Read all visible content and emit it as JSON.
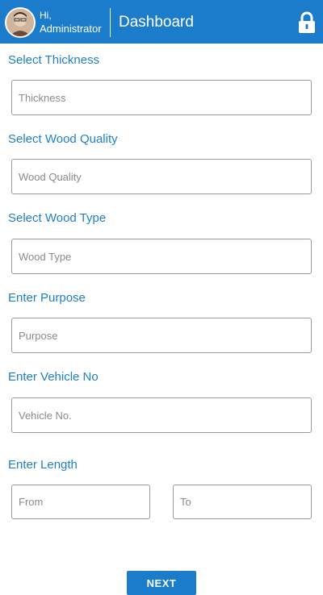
{
  "header": {
    "greeting": "Hi,",
    "user": "Administrator",
    "title": "Dashboard",
    "color": "#1c7ccc"
  },
  "form": {
    "thickness": {
      "label": "Select Thickness",
      "placeholder": "Thickness"
    },
    "wood_quality": {
      "label": "Select Wood Quality",
      "placeholder": "Wood Quality"
    },
    "wood_type": {
      "label": "Select Wood Type",
      "placeholder": "Wood Type"
    },
    "purpose": {
      "label": "Enter Purpose",
      "placeholder": "Purpose"
    },
    "vehicle": {
      "label": "Enter Vehicle No",
      "placeholder": "Vehicle No."
    },
    "length": {
      "label": "Enter Length",
      "from_placeholder": "From",
      "to_placeholder": "To"
    }
  },
  "actions": {
    "next_label": "NEXT"
  },
  "icons": {
    "avatar": "user-avatar",
    "lock": "lock-icon"
  }
}
